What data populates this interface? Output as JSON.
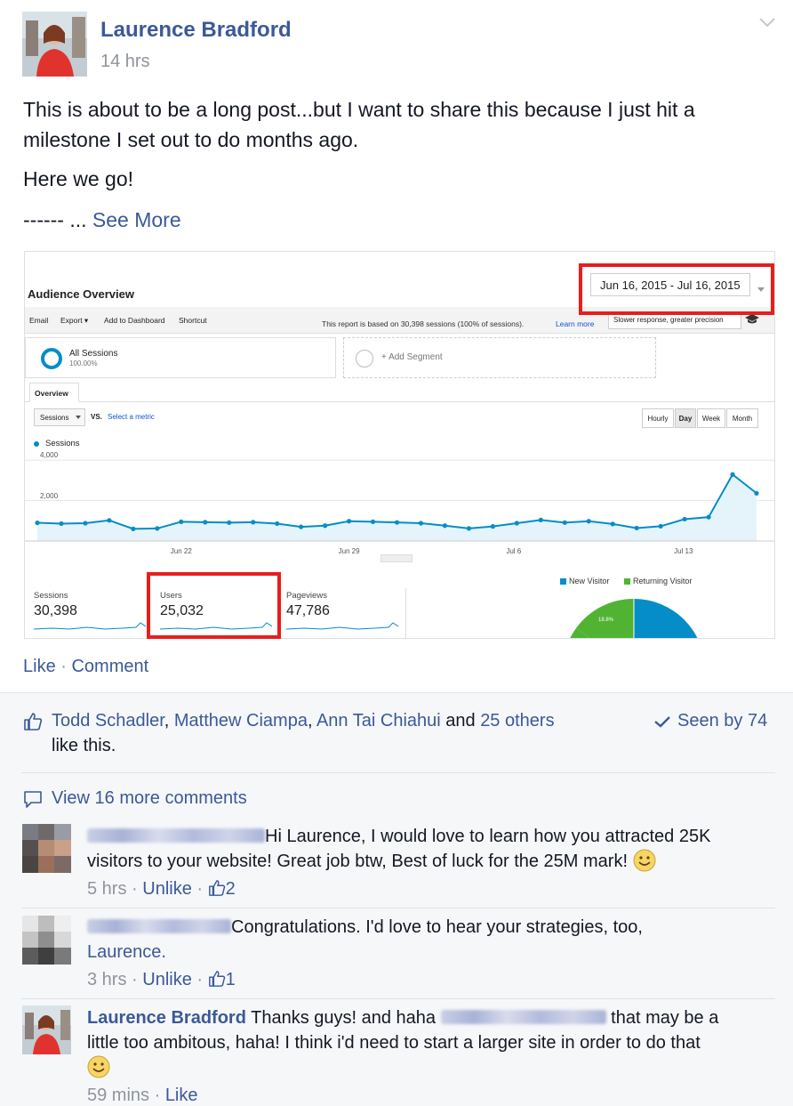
{
  "post": {
    "author": "Laurence Bradford",
    "time": "14 hrs",
    "paragraph1_line1": "This is about to be a long post...but I want to share this because I just hit a",
    "paragraph1_line2": "milestone I set out to do months ago.",
    "paragraph2": "Here we go!",
    "paragraph3_prefix": "------ ... ",
    "see_more": "See More"
  },
  "analytics": {
    "title": "Audience Overview",
    "date_range": "Jun 16, 2015 - Jul 16, 2015",
    "toolbar": [
      "Email",
      "Export ▾",
      "Add to Dashboard",
      "Shortcut"
    ],
    "report_note": "This report is based on 30,398 sessions (100% of sessions).",
    "learn_more": "Learn more",
    "precision": "Slower response, greater precision",
    "segment_name": "All Sessions",
    "segment_pct": "100.00%",
    "add_segment": "+ Add Segment",
    "tab": "Overview",
    "metric": "Sessions",
    "vs": "VS.",
    "select_metric": "Select a metric",
    "granularity": [
      "Hourly",
      "Day",
      "Week",
      "Month"
    ],
    "granularity_active": "Day",
    "legend": "Sessions",
    "scorecards": [
      {
        "label": "Sessions",
        "value": "30,398"
      },
      {
        "label": "Users",
        "value": "25,032"
      },
      {
        "label": "Pageviews",
        "value": "47,786"
      }
    ],
    "pie_legend": [
      {
        "label": "New Visitor",
        "color": "#058dc7"
      },
      {
        "label": "Returning Visitor",
        "color": "#50b432"
      }
    ],
    "pie_pct_label": "18.8%"
  },
  "chart_data": {
    "type": "line",
    "title": "",
    "series": [
      {
        "name": "Sessions",
        "values": [
          900,
          860,
          880,
          1020,
          600,
          620,
          950,
          930,
          910,
          930,
          860,
          700,
          760,
          980,
          950,
          920,
          880,
          760,
          620,
          720,
          880,
          1040,
          910,
          980,
          840,
          640,
          730,
          1080,
          1180,
          3290,
          2360
        ]
      }
    ],
    "x_tick_labels": [
      "Jun 22",
      "Jun 29",
      "Jul 6",
      "Jul 13"
    ],
    "x_tick_indices": [
      6,
      13,
      20,
      27
    ],
    "y_tick_labels": [
      "2,000",
      "4,000"
    ],
    "y_ticks": [
      2000,
      4000
    ],
    "ylim": [
      0,
      4400
    ],
    "grid": true
  },
  "actions": {
    "like": "Like",
    "separator": " · ",
    "comment": "Comment"
  },
  "likes": {
    "names": [
      "Todd Schadler",
      "Matthew Ciampa",
      "Ann Tai Chiahui"
    ],
    "and": " and ",
    "others": "25 others",
    "line2": "like this.",
    "seen_by": "Seen by 74"
  },
  "view_more_comments": "View 16 more comments",
  "comments": [
    {
      "text_line1": "Hi Laurence, I would love to learn how you attracted 25K",
      "text_line2": "visitors to your website! Great job btw, Best of luck for the 25M mark!",
      "time": "5 hrs",
      "action": "Unlike",
      "like_count": "2"
    },
    {
      "text_line1": "Congratulations. I'd love to hear your strategies, too,",
      "text_line2": "Laurence.",
      "time": "3 hrs",
      "action": "Unlike",
      "like_count": "1"
    },
    {
      "author": "Laurence Bradford",
      "text_line1": " Thanks guys! and haha ",
      "text_line1_end": " that may be a",
      "text_line2": "little too ambitous, haha! I think i'd need to start a larger site in order to do that",
      "time": "59 mins",
      "action": "Like"
    }
  ],
  "colors": {
    "link": "#3b5998",
    "muted": "#90949c",
    "highlight": "#ea1c1c",
    "ga_blue": "#058dc7",
    "ga_green": "#50b432"
  }
}
